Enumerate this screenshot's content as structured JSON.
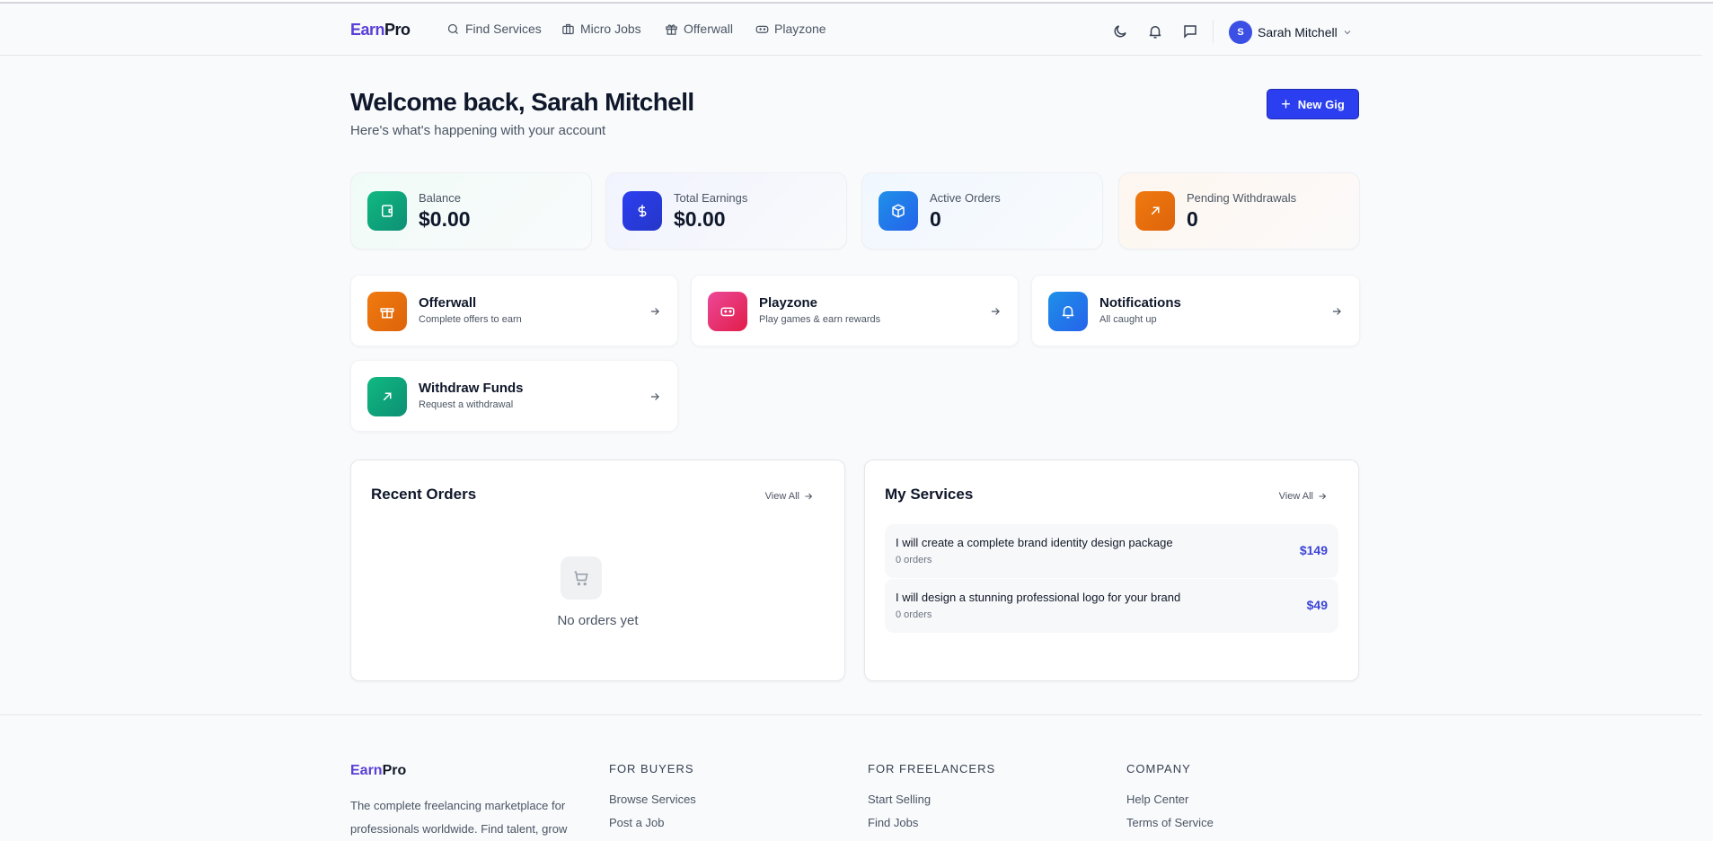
{
  "header": {
    "logo_a": "Earn",
    "logo_b": "Pro",
    "nav": [
      {
        "label": "Find Services",
        "icon": "search-icon"
      },
      {
        "label": "Micro Jobs",
        "icon": "briefcase-icon"
      },
      {
        "label": "Offerwall",
        "icon": "gift-icon"
      },
      {
        "label": "Playzone",
        "icon": "gamepad-icon"
      }
    ],
    "user_initial": "S",
    "user_name": "Sarah Mitchell"
  },
  "welcome": {
    "title": "Welcome back, Sarah Mitchell",
    "subtitle": "Here's what's happening with your account",
    "new_gig": "New Gig"
  },
  "stats": [
    {
      "label": "Balance",
      "value": "$0.00",
      "icon": "wallet-icon",
      "color": "#10a37f"
    },
    {
      "label": "Total Earnings",
      "value": "$0.00",
      "icon": "dollar-icon",
      "color": "#2b3ff0"
    },
    {
      "label": "Active Orders",
      "value": "0",
      "icon": "box-icon",
      "color": "#1e88e5"
    },
    {
      "label": "Pending Withdrawals",
      "value": "0",
      "icon": "arrow-up-right-icon",
      "color": "#ea6c0c"
    }
  ],
  "quick_links": [
    {
      "title": "Offerwall",
      "desc": "Complete offers to earn",
      "color": "#ea6c0c"
    },
    {
      "title": "Playzone",
      "desc": "Play games & earn rewards",
      "color": "#e52a6b"
    },
    {
      "title": "Notifications",
      "desc": "All caught up",
      "color": "#1e88e5"
    },
    {
      "title": "Withdraw Funds",
      "desc": "Request a withdrawal",
      "color": "#10a37f"
    }
  ],
  "recent_orders": {
    "title": "Recent Orders",
    "view_all": "View All",
    "empty": "No orders yet"
  },
  "my_services": {
    "title": "My Services",
    "view_all": "View All",
    "items": [
      {
        "title": "I will create a complete brand identity design package",
        "orders": "0 orders",
        "price": "$149"
      },
      {
        "title": "I will design a stunning professional logo for your brand",
        "orders": "0 orders",
        "price": "$49"
      }
    ]
  },
  "footer": {
    "logo_a": "Earn",
    "logo_b": "Pro",
    "desc": "The complete freelancing marketplace for professionals worldwide. Find talent, grow",
    "columns": [
      {
        "heading": "FOR BUYERS",
        "links": [
          "Browse Services",
          "Post a Job"
        ]
      },
      {
        "heading": "FOR FREELANCERS",
        "links": [
          "Start Selling",
          "Find Jobs"
        ]
      },
      {
        "heading": "COMPANY",
        "links": [
          "Help Center",
          "Terms of Service"
        ]
      }
    ]
  }
}
